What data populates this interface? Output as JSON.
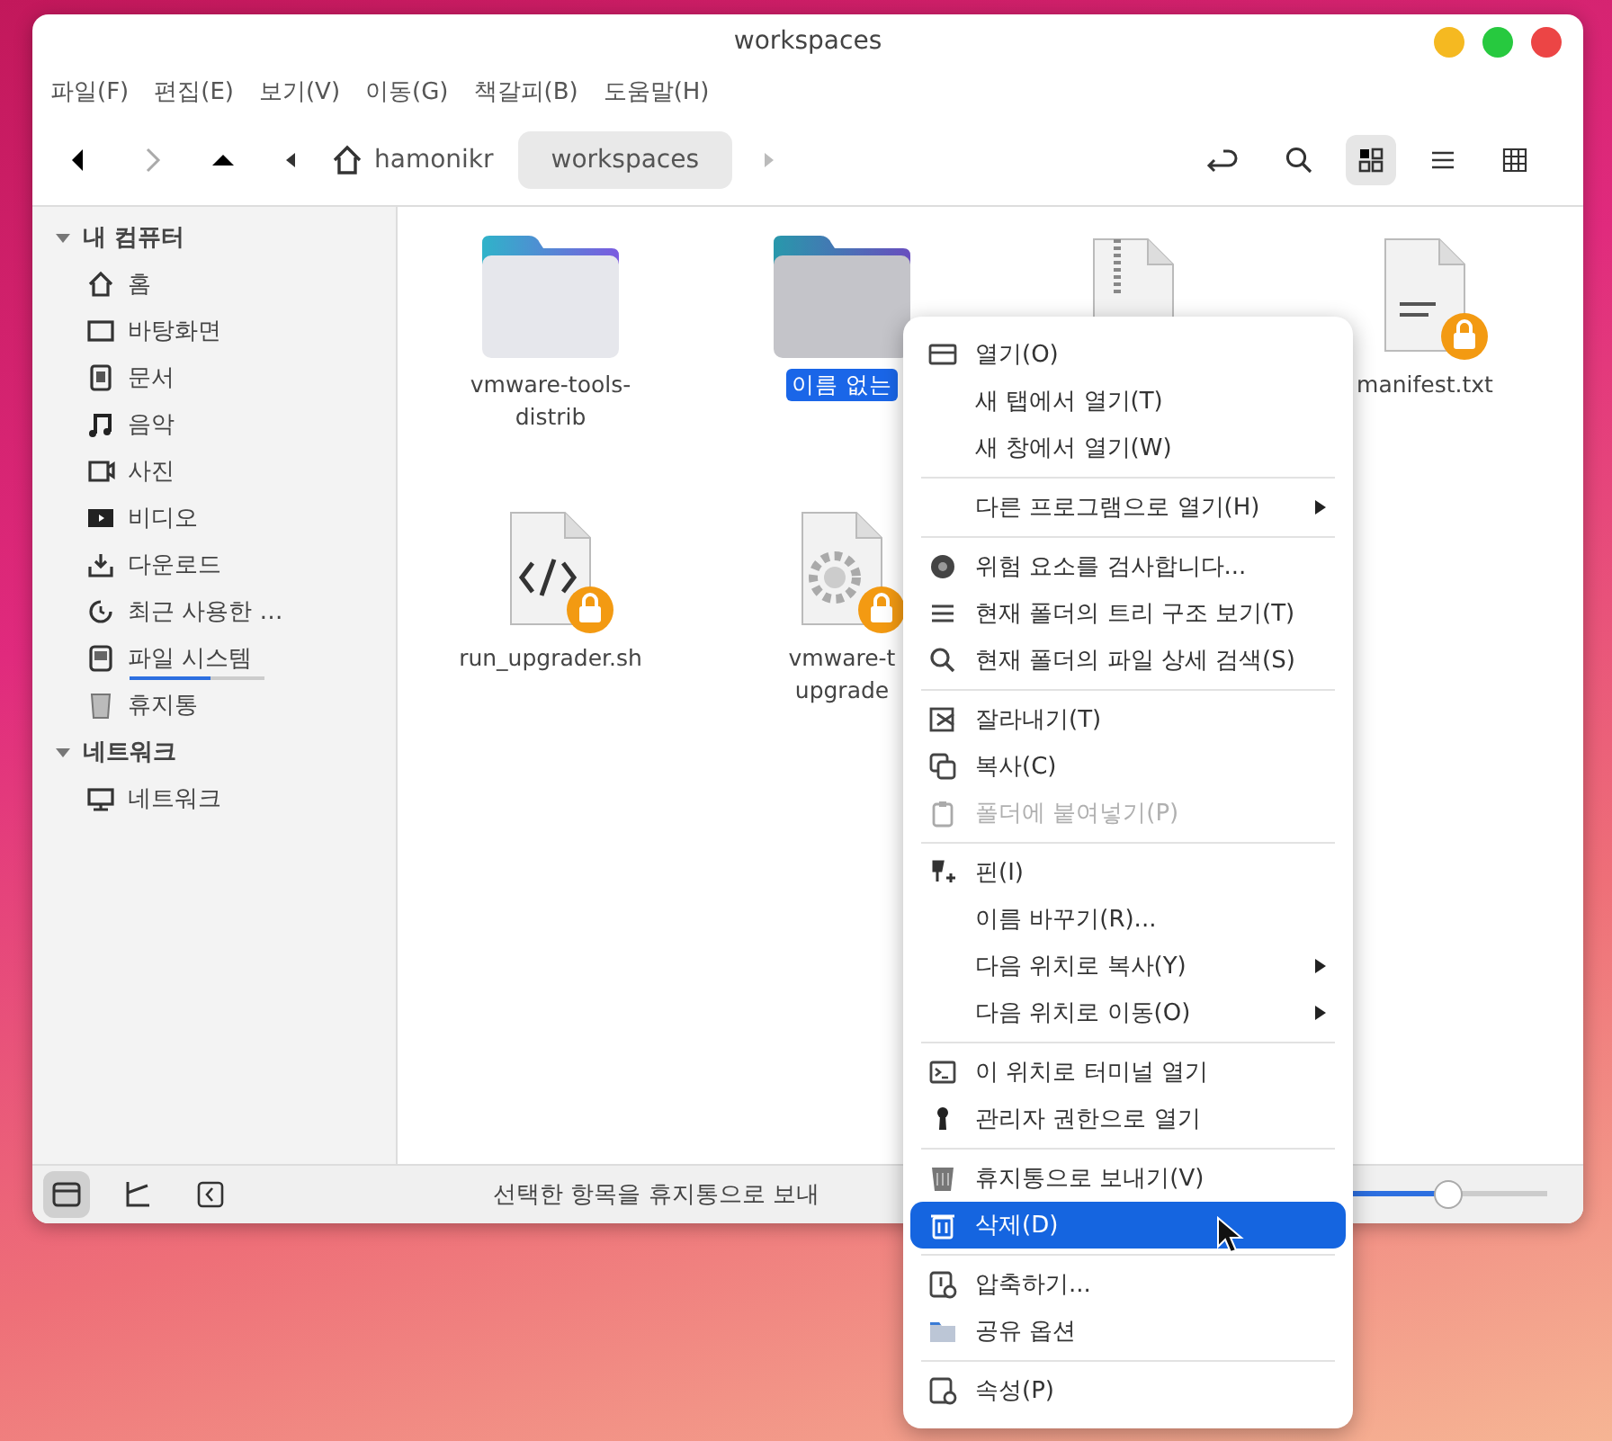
{
  "window": {
    "title": "workspaces"
  },
  "menubar": [
    "파일(F)",
    "편집(E)",
    "보기(V)",
    "이동(G)",
    "책갈피(B)",
    "도움말(H)"
  ],
  "breadcrumbs": [
    {
      "label": "hamonikr",
      "selected": false
    },
    {
      "label": "workspaces",
      "selected": true
    }
  ],
  "view_modes": [
    {
      "selected": true
    },
    {
      "selected": false
    },
    {
      "selected": false
    }
  ],
  "sidebar": {
    "sections": [
      {
        "label": "내 컴퓨터",
        "expanded": true,
        "children": [
          {
            "label": "홈"
          },
          {
            "label": "바탕화면"
          },
          {
            "label": "문서"
          },
          {
            "label": "음악"
          },
          {
            "label": "사진"
          },
          {
            "label": "비디오"
          },
          {
            "label": "다운로드"
          },
          {
            "label": "최근 사용한 …"
          },
          {
            "label": "파일 시스템",
            "level": 0.6
          },
          {
            "label": "휴지통"
          }
        ]
      },
      {
        "label": "네트워크",
        "expanded": true,
        "children": [
          {
            "label": "네트워크"
          }
        ]
      }
    ]
  },
  "files": [
    {
      "kind": "folder",
      "lines": [
        "vmware-tools-",
        "distrib"
      ],
      "selected": false,
      "locked": false
    },
    {
      "kind": "folder",
      "lines": [
        "이름 없는"
      ],
      "selected": true,
      "locked": false
    },
    {
      "kind": "archive",
      "selected": false,
      "locked": false
    },
    {
      "kind": "text",
      "lines": [
        "manifest.txt"
      ],
      "selected": false,
      "locked": true
    },
    {
      "kind": "script",
      "lines": [
        "run_upgrader.sh"
      ],
      "selected": false,
      "locked": true
    },
    {
      "kind": "executable",
      "lines": [
        "vmware-t",
        "upgrade"
      ],
      "selected": false,
      "locked": true
    }
  ],
  "status_bar": {
    "buttons": [
      {
        "selected": true
      },
      {
        "selected": false
      },
      {
        "selected": false
      }
    ],
    "text": "선택한 항목을 휴지통으로 보내",
    "zoom": {
      "level": 0.5
    }
  },
  "context_menu": {
    "groups": [
      [
        {
          "label": "열기(O)",
          "selected": false,
          "disabled": false,
          "submenu": false
        },
        {
          "label": "새 탭에서 열기(T)",
          "selected": false,
          "disabled": false,
          "submenu": false
        },
        {
          "label": "새 창에서 열기(W)",
          "selected": false,
          "disabled": false,
          "submenu": false
        }
      ],
      [
        {
          "label": "다른 프로그램으로 열기(H)",
          "selected": false,
          "disabled": false,
          "submenu": true
        }
      ],
      [
        {
          "label": "위험 요소를 검사합니다...",
          "selected": false,
          "disabled": false,
          "submenu": false
        },
        {
          "label": "현재 폴더의 트리 구조 보기(T)",
          "selected": false,
          "disabled": false,
          "submenu": false
        },
        {
          "label": "현재 폴더의 파일 상세 검색(S)",
          "selected": false,
          "disabled": false,
          "submenu": false
        }
      ],
      [
        {
          "label": "잘라내기(T)",
          "selected": false,
          "disabled": false,
          "submenu": false
        },
        {
          "label": "복사(C)",
          "selected": false,
          "disabled": false,
          "submenu": false
        },
        {
          "label": "폴더에 붙여넣기(P)",
          "selected": false,
          "disabled": true,
          "submenu": false
        }
      ],
      [
        {
          "label": "핀(I)",
          "selected": false,
          "disabled": false,
          "submenu": false
        },
        {
          "label": "이름 바꾸기(R)...",
          "selected": false,
          "disabled": false,
          "submenu": false
        },
        {
          "label": "다음 위치로 복사(Y)",
          "selected": false,
          "disabled": false,
          "submenu": true
        },
        {
          "label": "다음 위치로 이동(O)",
          "selected": false,
          "disabled": false,
          "submenu": true
        }
      ],
      [
        {
          "label": "이 위치로 터미널 열기",
          "selected": false,
          "disabled": false,
          "submenu": false
        },
        {
          "label": "관리자 권한으로 열기",
          "selected": false,
          "disabled": false,
          "submenu": false
        }
      ],
      [
        {
          "label": "휴지통으로 보내기(V)",
          "selected": false,
          "disabled": false,
          "submenu": false
        },
        {
          "label": "삭제(D)",
          "selected": true,
          "disabled": false,
          "submenu": false
        }
      ],
      [
        {
          "label": "압축하기...",
          "selected": false,
          "disabled": false,
          "submenu": false
        },
        {
          "label": "공유 옵션",
          "selected": false,
          "disabled": false,
          "submenu": false
        }
      ],
      [
        {
          "label": "속성(P)",
          "selected": false,
          "disabled": false,
          "submenu": false
        }
      ]
    ]
  }
}
